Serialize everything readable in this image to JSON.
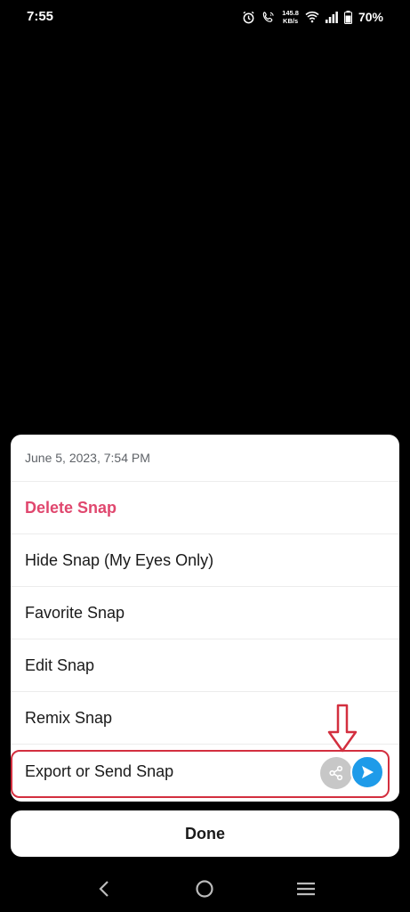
{
  "status_bar": {
    "time": "7:55",
    "speed_value": "145.8",
    "speed_unit": "KB/s",
    "battery": "70%"
  },
  "sheet": {
    "date": "June 5, 2023, 7:54 PM",
    "items": [
      {
        "label": "Delete Snap"
      },
      {
        "label": "Hide Snap (My Eyes Only)"
      },
      {
        "label": "Favorite Snap"
      },
      {
        "label": "Edit Snap"
      },
      {
        "label": "Remix Snap"
      },
      {
        "label": "Export or Send Snap"
      }
    ]
  },
  "done_label": "Done",
  "colors": {
    "delete": "#e0476e",
    "send": "#1e9be9",
    "highlight": "#d32f3f"
  },
  "icons": {
    "share": "share-icon",
    "send": "send-arrow-icon",
    "back": "back-icon",
    "home": "home-icon",
    "recents": "recents-icon"
  }
}
